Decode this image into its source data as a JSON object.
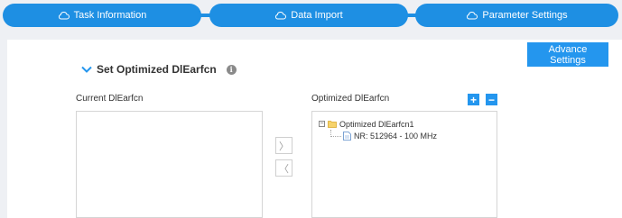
{
  "steps": [
    {
      "label": "Task Information",
      "icon": "cloud-icon"
    },
    {
      "label": "Data Import",
      "icon": "cloud-icon"
    },
    {
      "label": "Parameter Settings",
      "icon": "cloud-icon"
    }
  ],
  "colors": {
    "accent": "#1e8fe3",
    "button": "#2496ee",
    "background": "#eef0f4"
  },
  "toolbar": {
    "advance_label": "Advance Settings"
  },
  "section": {
    "title": "Set Optimized DlEarfcn",
    "icon": "chevron-down-icon",
    "info_icon": "info-icon",
    "info_glyph": "i"
  },
  "current": {
    "label": "Current DlEarfcn"
  },
  "optimized": {
    "label": "Optimized DlEarfcn",
    "add_glyph": "+",
    "remove_glyph": "−",
    "tree": {
      "root_label": "Optimized DlEarfcn1",
      "expander_glyph": "−",
      "child_label": "NR: 512964 - 100 MHz"
    }
  },
  "transfer": {
    "right_glyph": "〉",
    "left_glyph": "〈"
  }
}
